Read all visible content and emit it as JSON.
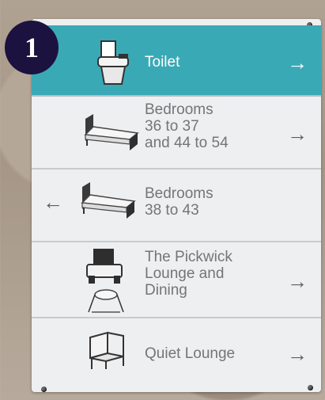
{
  "badge": {
    "number": "1"
  },
  "sign": {
    "panels": [
      {
        "label": "Toilet",
        "direction": "right",
        "arrow": "→",
        "icon": "toilet-icon",
        "highlight": true
      },
      {
        "label": "Bedrooms\n36 to 37\nand 44 to 54",
        "direction": "right",
        "arrow": "→",
        "icon": "bed-icon"
      },
      {
        "label": "Bedrooms\n38 to 43",
        "direction": "left",
        "arrow": "←",
        "icon": "bed-icon"
      },
      {
        "label": "The Pickwick\nLounge and\nDining",
        "direction": "right",
        "arrow": "→",
        "icon": "dining-chair-icon"
      },
      {
        "label": "Quiet Lounge",
        "direction": "right",
        "arrow": "→",
        "icon": "armchair-icon"
      }
    ]
  },
  "colors": {
    "highlight_panel": "#3aa9b6",
    "sign_background": "#eeeff0",
    "text": "#727676",
    "badge": "#1c1240"
  }
}
